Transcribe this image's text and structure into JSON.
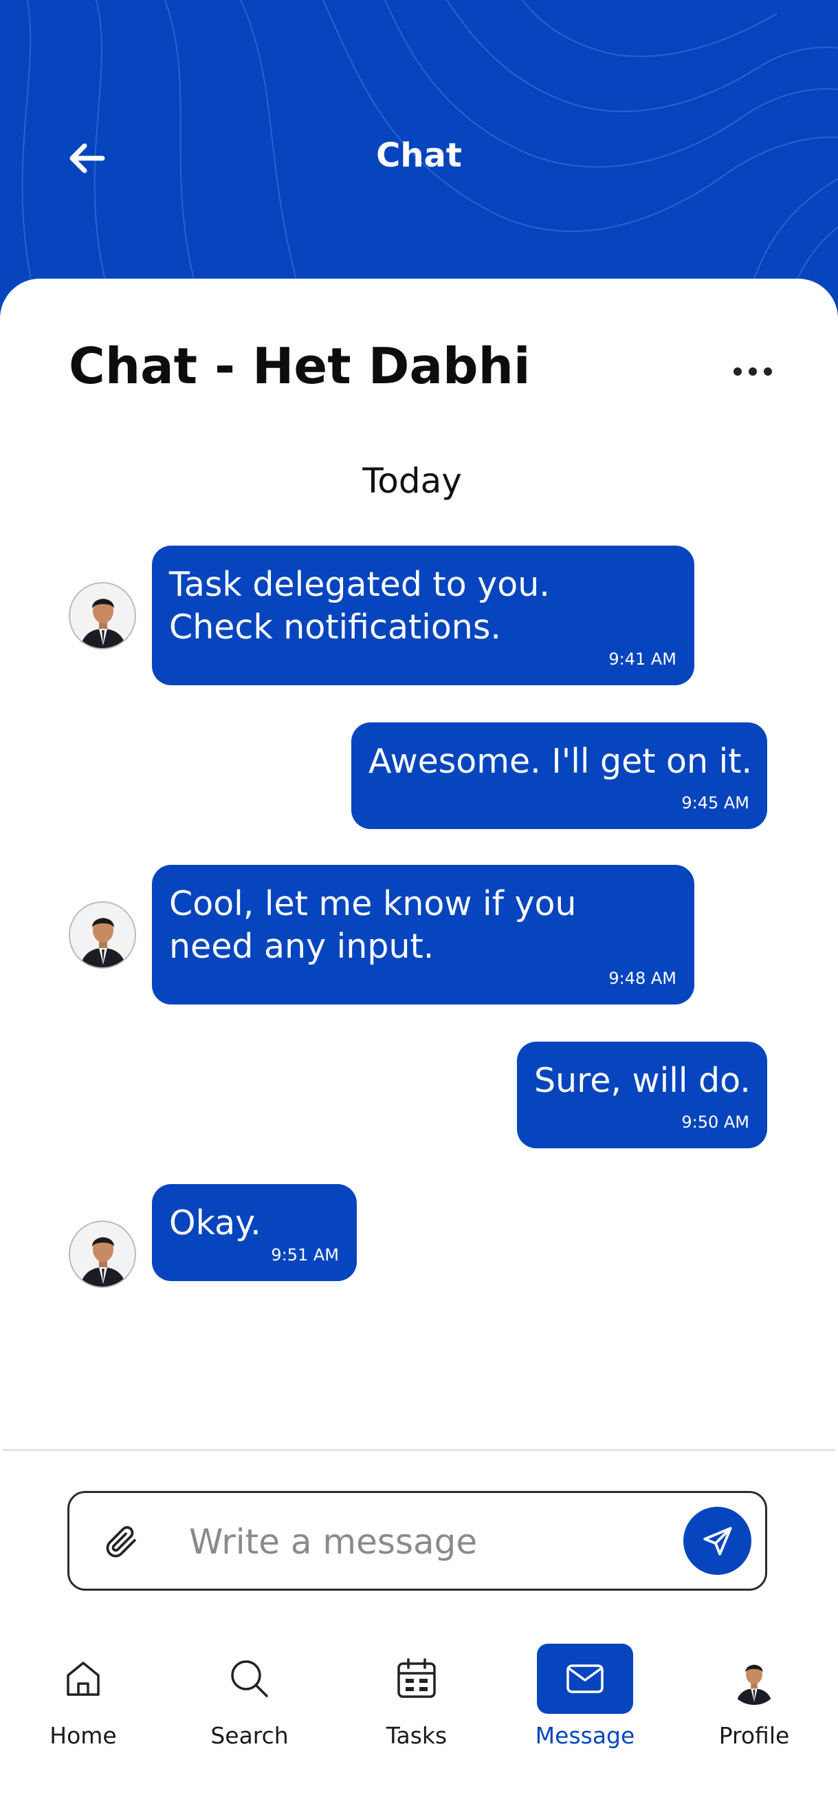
{
  "header": {
    "title": "Chat"
  },
  "chat": {
    "title": "Chat - Het Dabhi",
    "day_separator": "Today"
  },
  "messages": [
    {
      "direction": "incoming",
      "text": "Task delegated to you. Check notifications.",
      "time": "9:41 AM"
    },
    {
      "direction": "outgoing",
      "text": "Awesome. I'll get on it.",
      "time": "9:45 AM"
    },
    {
      "direction": "incoming",
      "text": "Cool, let me know if you need any input.",
      "time": "9:48 AM"
    },
    {
      "direction": "outgoing",
      "text": "Sure, will do.",
      "time": "9:50 AM"
    },
    {
      "direction": "incoming",
      "text": "Okay.",
      "time": "9:51 AM"
    }
  ],
  "composer": {
    "placeholder": "Write a message",
    "value": ""
  },
  "nav": {
    "items": [
      {
        "label": "Home",
        "icon": "home-icon",
        "active": false
      },
      {
        "label": "Search",
        "icon": "search-icon",
        "active": false
      },
      {
        "label": "Tasks",
        "icon": "calendar-icon",
        "active": false
      },
      {
        "label": "Message",
        "icon": "mail-icon",
        "active": true
      },
      {
        "label": "Profile",
        "icon": "avatar",
        "active": false
      }
    ]
  },
  "colors": {
    "accent": "#0645be",
    "text": "#0d0d0d",
    "background": "#ffffff"
  }
}
